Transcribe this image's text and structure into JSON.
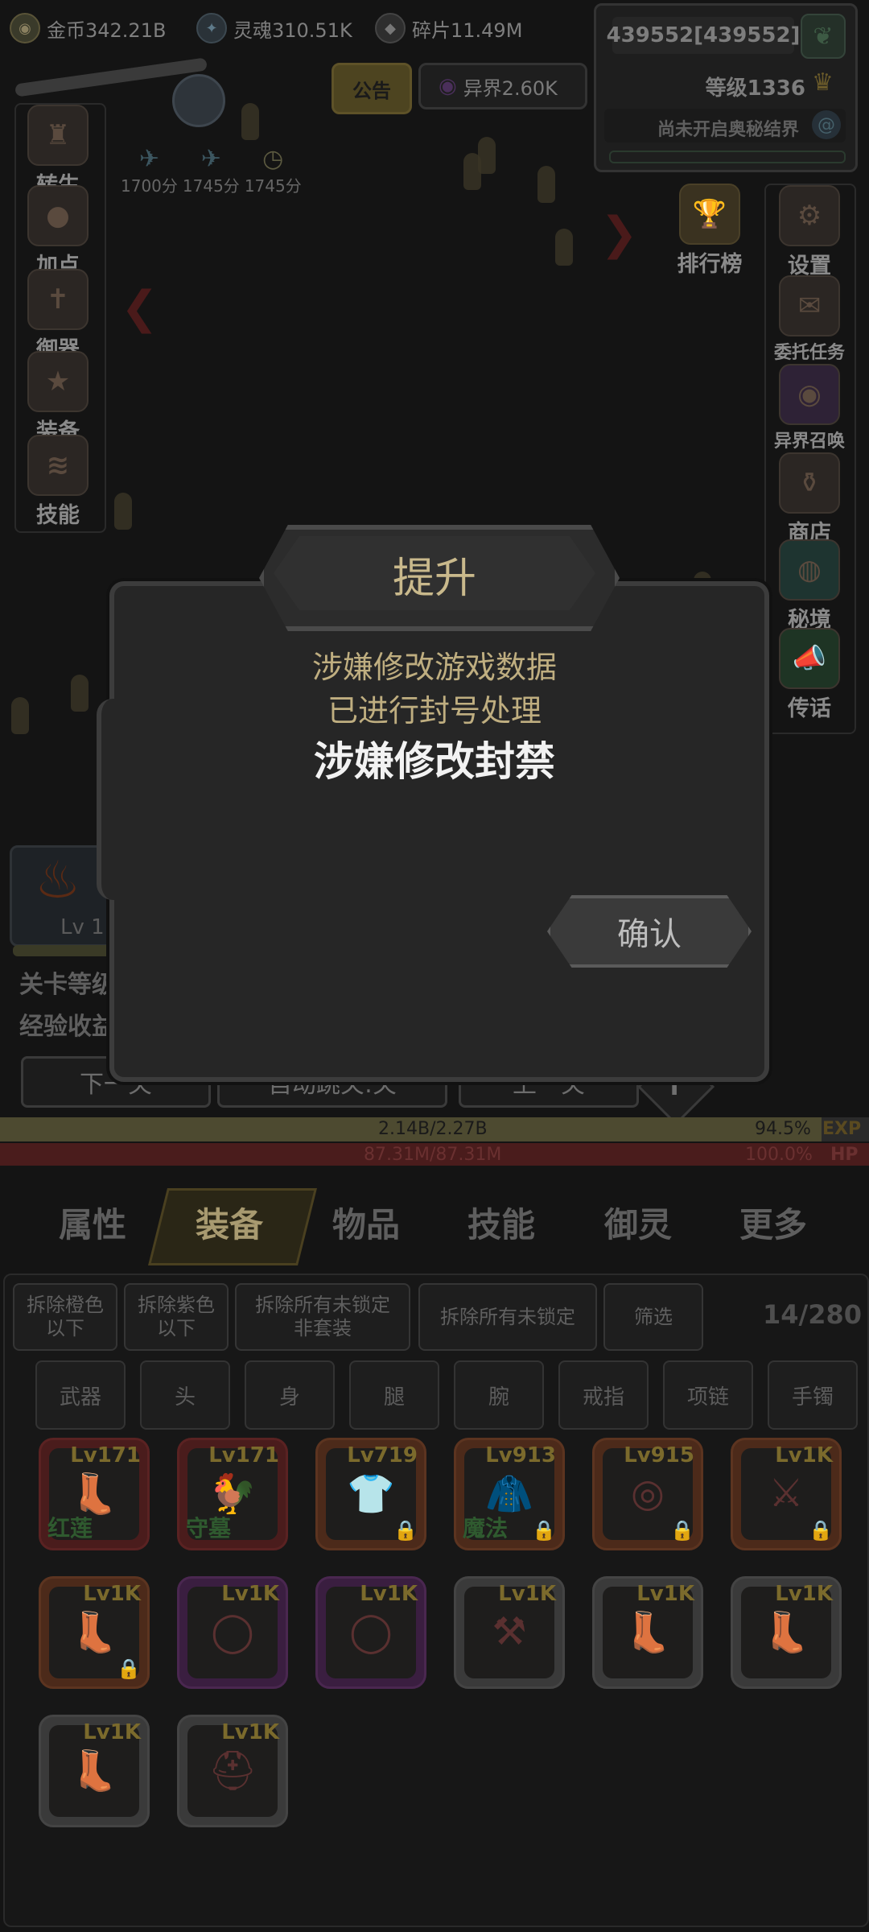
{
  "resources": {
    "gold": "金币342.21B",
    "soul": "灵魂310.51K",
    "shard": "碎片11.49M",
    "otherworld": "异界2.60K"
  },
  "notice_label": "公告",
  "player": {
    "power": "439552[439552]",
    "level": "等级1336",
    "realm": "尚未开启奥秘结界"
  },
  "left_menu": [
    {
      "label": "转生",
      "icon": "rebirth-icon"
    },
    {
      "label": "加点",
      "icon": "meat-icon"
    },
    {
      "label": "御器",
      "icon": "sword-icon"
    },
    {
      "label": "装备",
      "icon": "armor-icon"
    },
    {
      "label": "技能",
      "icon": "scroll-icon"
    }
  ],
  "right_menu": [
    {
      "label": "设置",
      "icon": "gear-icon"
    },
    {
      "label": "委托任务",
      "icon": "quest-icon"
    },
    {
      "label": "异界召唤",
      "icon": "portal-icon"
    },
    {
      "label": "商店",
      "icon": "shop-icon"
    },
    {
      "label": "秘境",
      "icon": "secret-realm-icon"
    },
    {
      "label": "传话",
      "icon": "megaphone-icon"
    }
  ],
  "ranking_label": "排行榜",
  "buffs": [
    "1700分",
    "1745分",
    "1745分"
  ],
  "monster": {
    "level": "Lv 1"
  },
  "stage_info": {
    "line1": "关卡等级",
    "line2": "经验收益"
  },
  "stage_buttons": {
    "next": "下一关",
    "auto": "自动跳关:关",
    "prev": "上一关"
  },
  "bars": {
    "exp_text": "2.14B/2.27B",
    "exp_pct": "94.5%",
    "exp_label": "EXP",
    "exp_fraction": 0.945,
    "hp_text": "87.31M/87.31M",
    "hp_pct": "100.0%",
    "hp_label": "HP",
    "hp_fraction": 1.0
  },
  "tabs": [
    "属性",
    "装备",
    "物品",
    "技能",
    "御灵",
    "更多"
  ],
  "active_tab": "装备",
  "filters": {
    "f1": "拆除橙色\n以下",
    "f2": "拆除紫色\n以下",
    "f3": "拆除所有未锁定\n非套装",
    "f4": "拆除所有未锁定",
    "f5": "筛选",
    "count": "14/280"
  },
  "slot_tabs": [
    "武器",
    "头",
    "身",
    "腿",
    "腕",
    "戒指",
    "项链",
    "手镯"
  ],
  "items": [
    {
      "lv": "Lv171",
      "name": "红莲",
      "quality": "red",
      "glyph": "👢",
      "locked": false
    },
    {
      "lv": "Lv171",
      "name": "守墓",
      "quality": "red",
      "glyph": "🐓",
      "locked": false
    },
    {
      "lv": "Lv719",
      "name": "",
      "quality": "orange",
      "glyph": "👕",
      "locked": true
    },
    {
      "lv": "Lv913",
      "name": "魔法",
      "quality": "orange",
      "glyph": "🧥",
      "locked": true
    },
    {
      "lv": "Lv915",
      "name": "",
      "quality": "orange",
      "glyph": "◎",
      "locked": true
    },
    {
      "lv": "Lv1K",
      "name": "",
      "quality": "orange",
      "glyph": "⚔",
      "locked": true
    },
    {
      "lv": "Lv1K",
      "name": "",
      "quality": "orange",
      "glyph": "👢",
      "locked": true
    },
    {
      "lv": "Lv1K",
      "name": "",
      "quality": "purple",
      "glyph": "◯",
      "locked": false
    },
    {
      "lv": "Lv1K",
      "name": "",
      "quality": "purple",
      "glyph": "◯",
      "locked": false
    },
    {
      "lv": "Lv1K",
      "name": "",
      "quality": "gray",
      "glyph": "⚒",
      "locked": false
    },
    {
      "lv": "Lv1K",
      "name": "",
      "quality": "gray",
      "glyph": "👢",
      "locked": false
    },
    {
      "lv": "Lv1K",
      "name": "",
      "quality": "gray",
      "glyph": "👢",
      "locked": false
    },
    {
      "lv": "Lv1K",
      "name": "",
      "quality": "gray",
      "glyph": "👢",
      "locked": false
    },
    {
      "lv": "Lv1K",
      "name": "",
      "quality": "gray",
      "glyph": "⛑",
      "locked": false
    }
  ],
  "dialog": {
    "title": "提升",
    "message1": "涉嫌修改游戏数据",
    "message2": "已进行封号处理",
    "emphasis": "涉嫌修改封禁",
    "confirm": "确认"
  }
}
